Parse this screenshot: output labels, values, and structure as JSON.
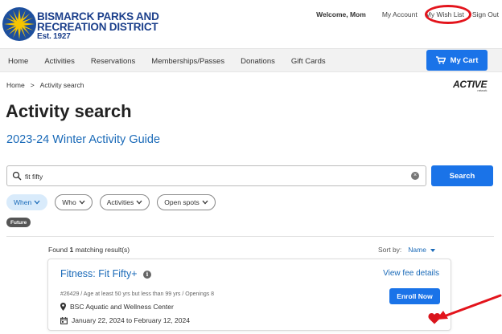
{
  "org": {
    "line1": "BISMARCK PARKS AND",
    "line2": "RECREATION DISTRICT",
    "est": "Est. 1927",
    "colors": {
      "navy": "#1b3f8b",
      "sun_yellow": "#f6c400",
      "sun_blue": "#1d4f9e"
    }
  },
  "topnav": {
    "welcome": "Welcome, Mom",
    "my_account": "My Account",
    "my_wish_list": "My Wish List",
    "sign_out": "Sign Out"
  },
  "mainnav": {
    "items": [
      "Home",
      "Activities",
      "Reservations",
      "Memberships/Passes",
      "Donations",
      "Gift Cards"
    ],
    "cart_label": "My Cart"
  },
  "breadcrumb": {
    "home": "Home",
    "separator": ">",
    "current": "Activity search"
  },
  "active_logo": {
    "text": "ACTIVE",
    "sub": "network"
  },
  "page": {
    "title": "Activity search",
    "guide_link": "2023-24 Winter Activity Guide"
  },
  "search": {
    "value": "fit fifty",
    "button_label": "Search"
  },
  "filters": {
    "when": "When",
    "who": "Who",
    "activities": "Activities",
    "open_spots": "Open spots",
    "future_tag": "Future"
  },
  "results": {
    "found_prefix": "Found",
    "count": "1",
    "found_suffix": "matching result(s)",
    "sort_label": "Sort by:",
    "sort_value": "Name"
  },
  "activity": {
    "title": "Fitness: Fit Fifty+",
    "fee_link": "View fee details",
    "meta": "#26429 / Age at least 50 yrs but less than 99 yrs / Openings 8",
    "location": "BSC Aquatic and Wellness Center",
    "dates": "January 22, 2024 to February 12, 2024",
    "enroll_label": "Enroll Now"
  },
  "colors": {
    "primary": "#1a73e8",
    "link": "#1a6ab8",
    "annotation_red": "#e3141c",
    "heart_red": "#d9141c"
  }
}
